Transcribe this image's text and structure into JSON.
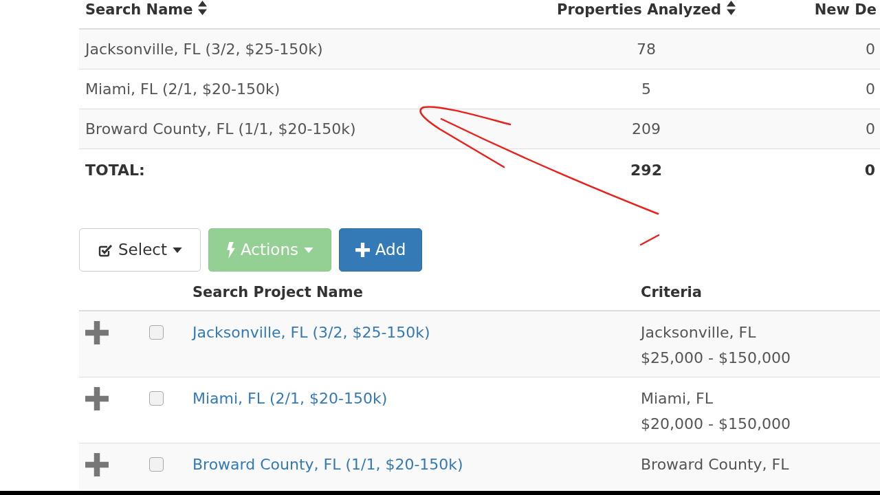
{
  "summary_table": {
    "columns": [
      {
        "label": "Search Name",
        "sortable": true
      },
      {
        "label": "Properties Analyzed",
        "sortable": true
      },
      {
        "label": "New De",
        "sortable": false
      }
    ],
    "rows": [
      {
        "search_name": "Jacksonville, FL (3/2, $25-150k)",
        "properties_analyzed": "78",
        "column_3": "0"
      },
      {
        "search_name": "Miami, FL (2/1, $20-150k)",
        "properties_analyzed": "5",
        "column_3": "0"
      },
      {
        "search_name": "Broward County, FL (1/1, $20-150k)",
        "properties_analyzed": "209",
        "column_3": "0"
      }
    ],
    "total": {
      "label": "TOTAL:",
      "properties_analyzed": "292",
      "column_3": "0"
    }
  },
  "toolbar": [
    {
      "kind": "select",
      "label": "Select",
      "dropdown": true,
      "disabled": false
    },
    {
      "kind": "actions",
      "label": "Actions",
      "dropdown": true,
      "disabled": true
    },
    {
      "kind": "add",
      "label": "Add",
      "dropdown": false,
      "disabled": false
    }
  ],
  "projects_table": {
    "columns": [
      "Search Project Name",
      "Criteria"
    ],
    "rows": [
      {
        "expanded": false,
        "checked": false,
        "name": "Jacksonville, FL (3/2, $25-150k)",
        "criteria": [
          "Jacksonville, FL",
          "$25,000 - $150,000"
        ]
      },
      {
        "expanded": false,
        "checked": false,
        "name": "Miami, FL (2/1, $20-150k)",
        "criteria": [
          "Miami, FL",
          "$20,000 - $150,000"
        ]
      },
      {
        "expanded": false,
        "checked": false,
        "name": "Broward County, FL (1/1, $20-150k)",
        "criteria": [
          "Broward County, FL"
        ]
      }
    ]
  }
}
